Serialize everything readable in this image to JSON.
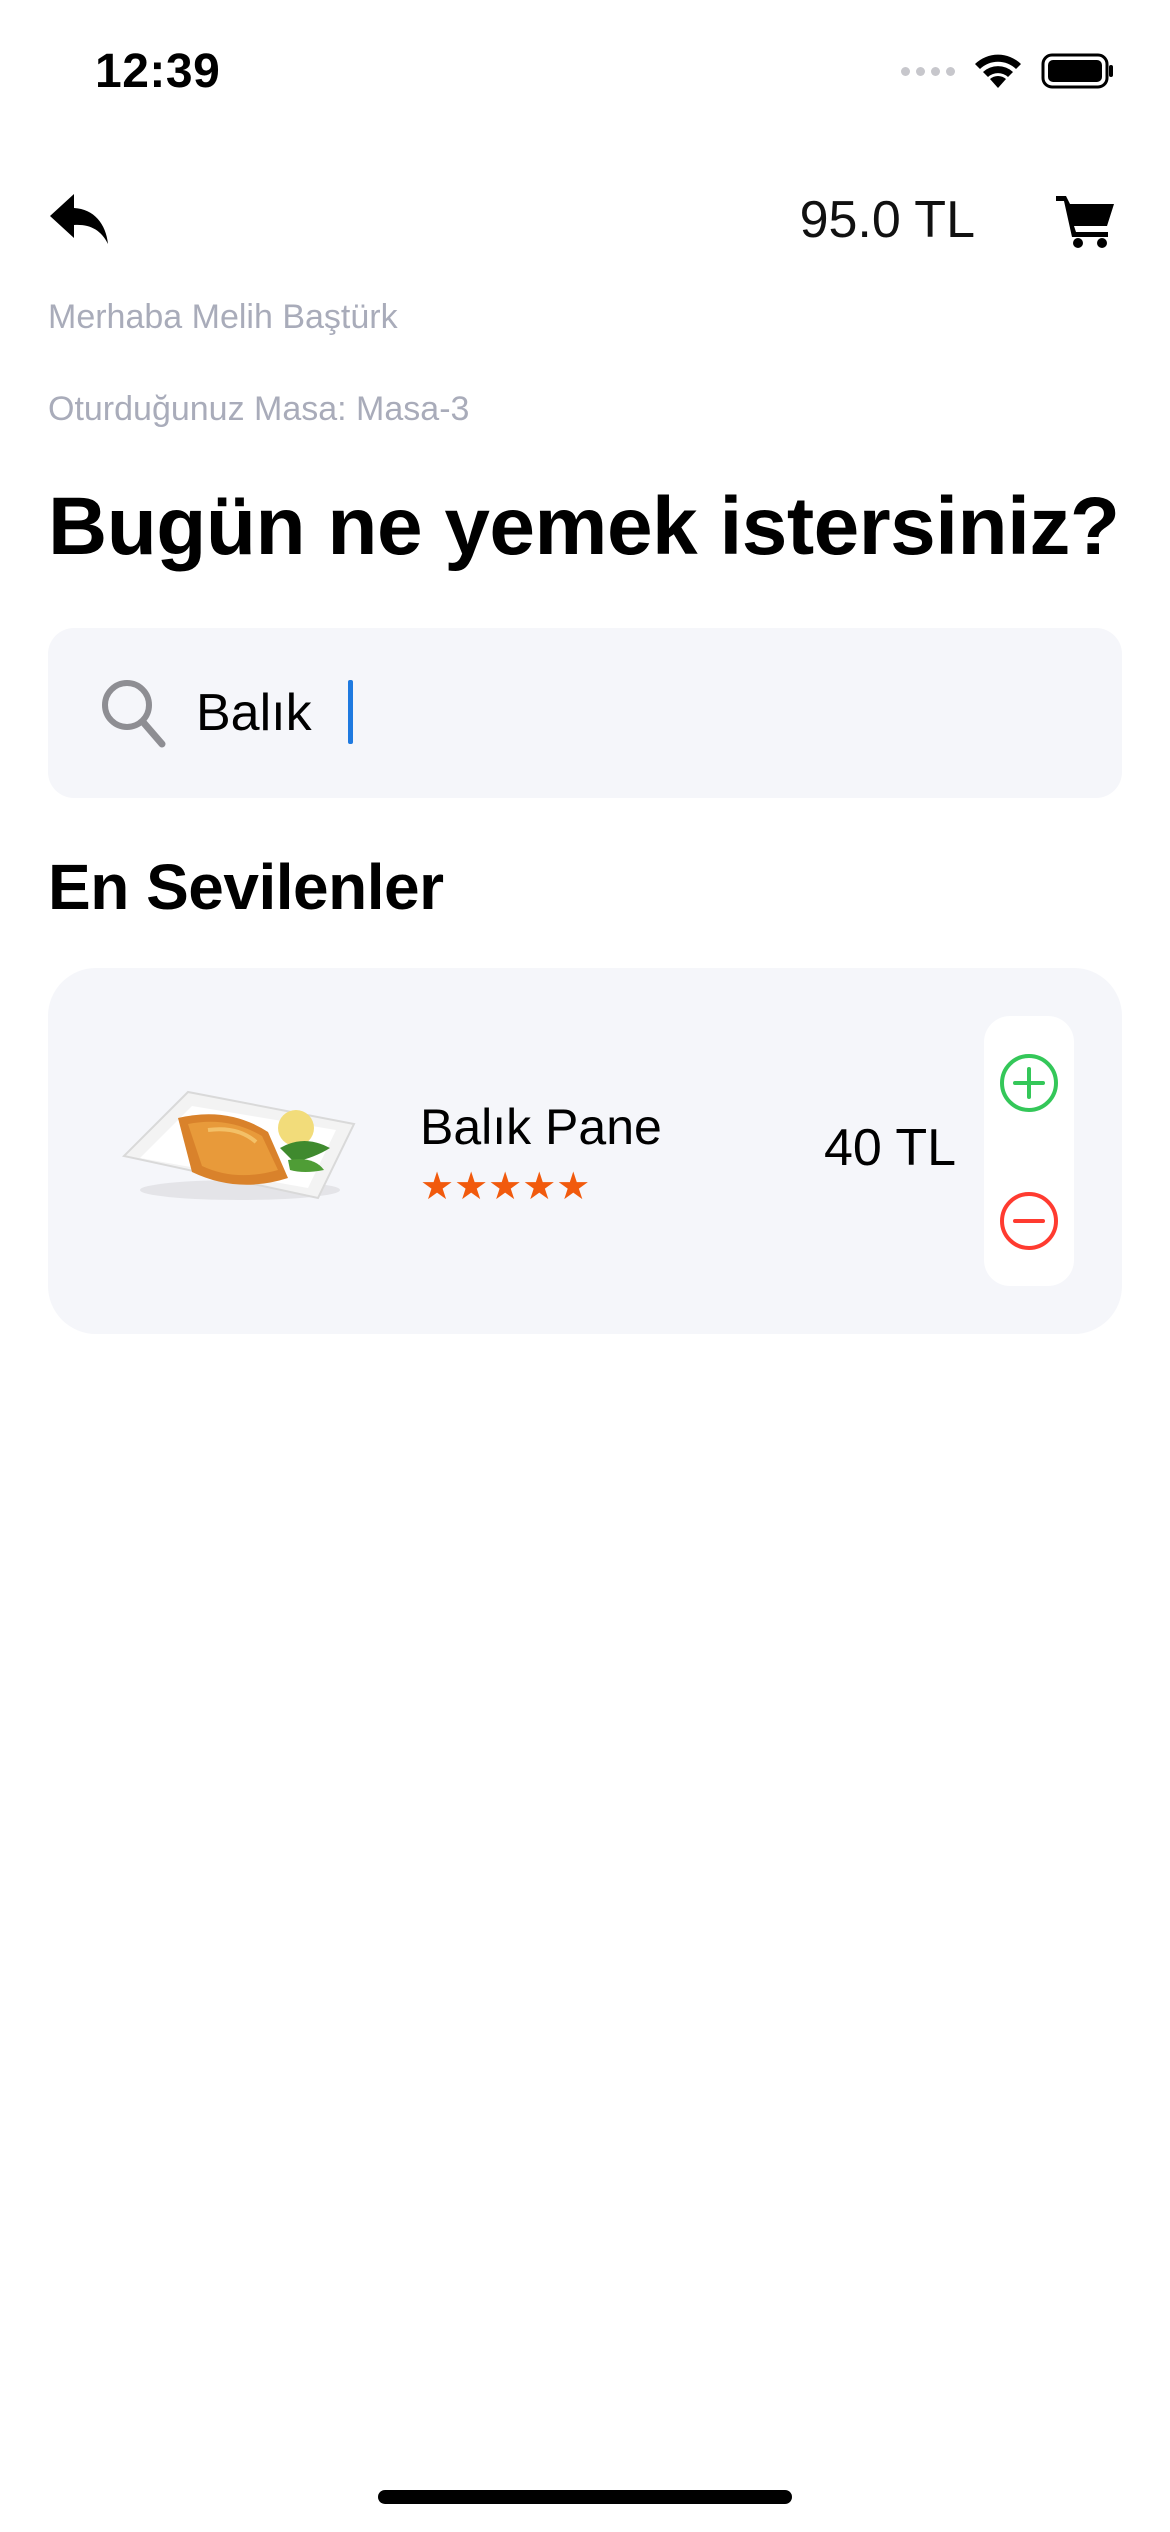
{
  "status_bar": {
    "time": "12:39",
    "icons": [
      "signal-dots-icon",
      "wifi-icon",
      "battery-icon"
    ]
  },
  "header": {
    "back_icon": "reply-arrow-icon",
    "cart_total": "95.0 TL",
    "cart_icon": "shopping-cart-icon"
  },
  "greeting": "Merhaba Melih Baştürk",
  "table_info": "Oturduğunuz Masa: Masa-3",
  "page_title": "Bugün ne yemek istersiniz?",
  "search": {
    "value": "Balık",
    "icon": "search-icon"
  },
  "section_title": "En Sevilenler",
  "products": [
    {
      "name": "Balık Pane",
      "price": "40 TL",
      "rating": 5,
      "stars": "★★★★★",
      "image": "fried-fish-plate-image"
    }
  ],
  "colors": {
    "accent_star": "#f15a0d",
    "add_button": "#34c759",
    "remove_button": "#ff3b30",
    "caret": "#1f7ae0",
    "muted_text": "#a9acba",
    "card_background": "#f5f6fa"
  }
}
